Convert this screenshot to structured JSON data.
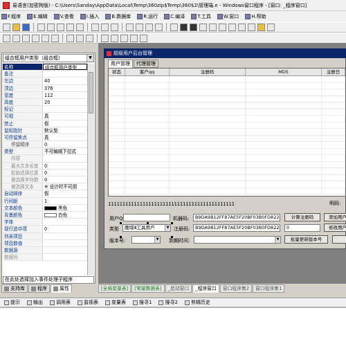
{
  "window": {
    "title": "易语言(加密狗版) - C:\\Users\\Sanday\\AppData\\Local\\Temp\\360zip$Temp\\360$2\\管理端.e - Windows窗口程序 - [窗口: _程序窗口]"
  },
  "menu": [
    "F.程序",
    "E.编辑",
    "V.查看",
    "I.插入",
    "B.数据库",
    "R.运行",
    "C.编译",
    "T.工具",
    "W.窗口",
    "H.帮助"
  ],
  "left_panel": {
    "combo_value": "组合框用户类型（组合框）",
    "bottom_dropdown": "在此处选择加入事件处理子程序",
    "properties": [
      {
        "name": "名称",
        "value": "组合框用户类型",
        "selected": true
      },
      {
        "name": "备注",
        "value": ""
      },
      {
        "name": "左边",
        "value": "40"
      },
      {
        "name": "顶边",
        "value": "376"
      },
      {
        "name": "宽度",
        "value": "112"
      },
      {
        "name": "高度",
        "value": "20"
      },
      {
        "name": "标记",
        "value": ""
      },
      {
        "name": "可视",
        "value": "真"
      },
      {
        "name": "禁止",
        "value": "假"
      },
      {
        "name": "鼠标指针",
        "value": "默认型"
      },
      {
        "name": "可停留焦点",
        "value": "真"
      },
      {
        "name": "停留顺序",
        "value": "0",
        "sub": true
      },
      {
        "name": "类型",
        "value": "不可编辑下拉式"
      },
      {
        "name": "内容",
        "value": "",
        "sub": true,
        "gray": true
      },
      {
        "name": "最大文本长度",
        "value": "0",
        "sub": true,
        "gray": true
      },
      {
        "name": "起始选择位置",
        "value": "0",
        "sub": true,
        "gray": true
      },
      {
        "name": "被选择字符数",
        "value": "0",
        "sub": true,
        "gray": true
      },
      {
        "name": "被选择文本",
        "value": "※ 设计时不可用",
        "sub": true,
        "gray": true
      },
      {
        "name": "自动排序",
        "value": "假"
      },
      {
        "name": "行间距",
        "value": "1"
      },
      {
        "name": "文本颜色",
        "value": "黑色",
        "swatch": "#000000"
      },
      {
        "name": "背景颜色",
        "value": "白色",
        "swatch": "#ffffff"
      },
      {
        "name": "字体",
        "value": ""
      },
      {
        "name": "现行选中项",
        "value": "0"
      },
      {
        "name": "列表项目",
        "value": ""
      },
      {
        "name": "项目数值",
        "value": ""
      },
      {
        "name": "数据源",
        "value": ""
      },
      {
        "name": "数据列",
        "value": "",
        "gray": true
      }
    ],
    "tabs": [
      "支持库",
      "程序",
      "属性"
    ]
  },
  "designer": {
    "title": "超级用户后台管理",
    "tabs": [
      "用户管理",
      "代理管理"
    ],
    "grid_columns": [
      "状态",
      "客户qq",
      "注册码",
      "MD5",
      "注册日"
    ],
    "digit_string": "11111111111111111111111111111111111111111111",
    "account_label": "明码:",
    "user_qq_label": "用户QQ:",
    "machine_code_label": "机器码:",
    "machine_code_value": "B9DA9B12FF87AE5F20BF03B0FD822217",
    "calc_button": "计算注册码",
    "add_user_button": "添加用户",
    "type_label": "类型",
    "type_value": "魔域Ⅲ工具用户",
    "reg_code_label": "注册码:",
    "reg_code_value": "B9DA9B12FF87AE5F20BF03B0FD822217",
    "count_value": "0",
    "modify_user_button": "修改用户",
    "version_label": "版本号:",
    "expiry_label": "到期时间:",
    "batch_update_button": "批量更新版本号"
  },
  "doc_tabs": [
    {
      "label": "[全局变量表]",
      "style": "green"
    },
    {
      "label": "[常量数据表]",
      "style": "green"
    },
    {
      "label": "_启动窗口",
      "style": "normal"
    },
    {
      "label": "_程序窗口",
      "style": "active"
    },
    {
      "label": "窗口程序集2",
      "style": "normal"
    },
    {
      "label": "窗口程序集1",
      "style": "normal"
    }
  ],
  "output_tabs": [
    "提示",
    "输出",
    "调用表",
    "监视表",
    "变量表",
    "搜寻1",
    "搜寻2",
    "剪辑历史"
  ]
}
